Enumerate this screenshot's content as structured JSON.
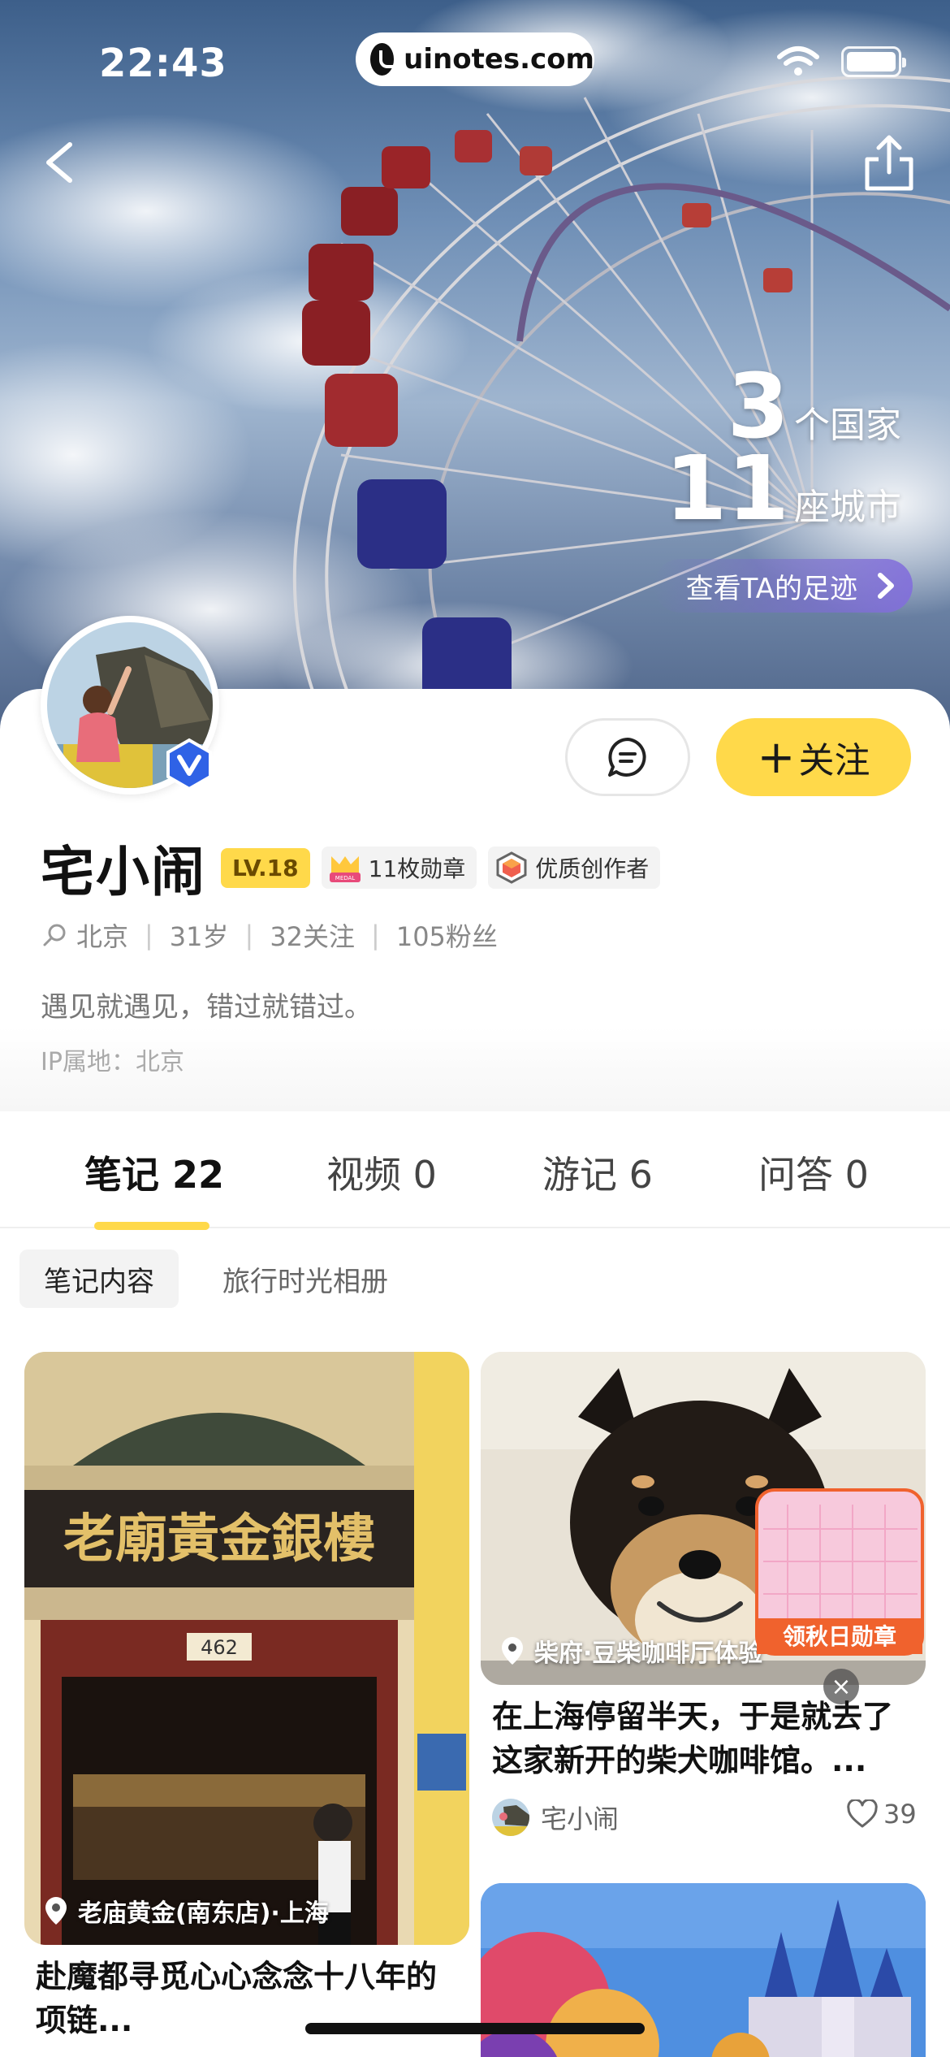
{
  "status_bar": {
    "time": "22:43",
    "url": "uinotes.com"
  },
  "hero": {
    "countries_count": "3",
    "countries_unit": "个国家",
    "cities_count": "11",
    "cities_unit": "座城市",
    "footprint_link": "查看TA的足迹"
  },
  "profile": {
    "name": "宅小闹",
    "level": "LV.18",
    "medal_count": "11枚勋章",
    "medal_icon_text": "MEDAL",
    "creator_badge": "优质创作者",
    "location": "北京",
    "age": "31岁",
    "following": "32关注",
    "followers": "105粉丝",
    "bio": "遇见就遇见，错过就错过。",
    "ip_location": "IP属地：北京",
    "follow_label": "关注",
    "follow_plus": "+"
  },
  "tabs": [
    {
      "label": "笔记 22",
      "active": true
    },
    {
      "label": "视频 0",
      "active": false
    },
    {
      "label": "游记 6",
      "active": false
    },
    {
      "label": "问答 0",
      "active": false
    }
  ],
  "subtabs": [
    {
      "label": "笔记内容",
      "active": true
    },
    {
      "label": "旅行时光相册",
      "active": false
    }
  ],
  "feed": {
    "left": [
      {
        "sign_text": "老廟黃金銀樓",
        "door_number": "462",
        "location": "老庙黄金(南东店)·上海",
        "title_line1": "赴魔都寻觅心心念念十八年的",
        "title_line2": "项链..."
      }
    ],
    "right": [
      {
        "location": "柴府·豆柴咖啡厅体验",
        "title_line1": "在上海停留半天，于是就去了",
        "title_line2": "这家新开的柴犬咖啡馆。...",
        "author": "宅小闹",
        "likes": "39"
      }
    ]
  },
  "promo": {
    "label": "领秋日勋章",
    "close": "×"
  },
  "colors": {
    "accent_yellow": "#ffd94a",
    "text_primary": "#111111",
    "text_secondary": "#888888",
    "promo_orange": "#f0622d"
  }
}
